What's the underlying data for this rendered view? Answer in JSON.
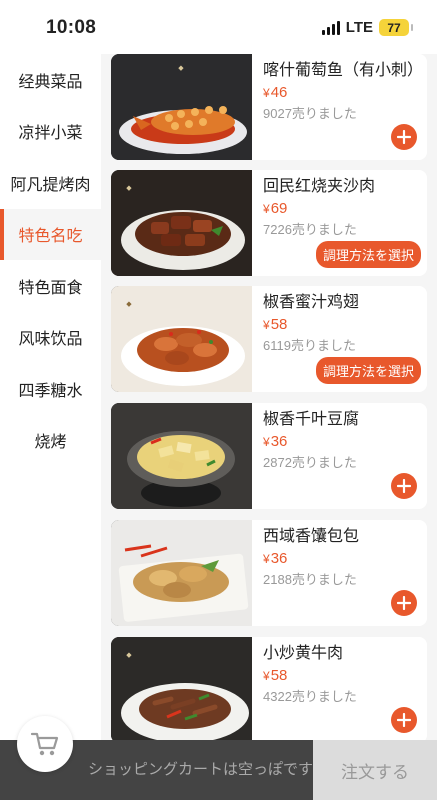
{
  "status": {
    "time": "10:08",
    "network": "LTE",
    "battery": "77"
  },
  "sidebar": {
    "items": [
      {
        "label": "经典菜品",
        "active": false
      },
      {
        "label": "凉拌小菜",
        "active": false
      },
      {
        "label": "阿凡提烤肉",
        "active": false
      },
      {
        "label": "特色名吃",
        "active": true
      },
      {
        "label": "特色面食",
        "active": false
      },
      {
        "label": "风味饮品",
        "active": false
      },
      {
        "label": "四季糖水",
        "active": false
      },
      {
        "label": "烧烤",
        "active": false
      }
    ]
  },
  "menu": {
    "currency": "¥",
    "items": [
      {
        "name": "喀什葡萄鱼（有小刺）",
        "price": "46",
        "sold": "9027売りました",
        "action": "add"
      },
      {
        "name": "回民红烧夹沙肉",
        "price": "69",
        "sold": "7226売りました",
        "action": "option",
        "option_label": "調理方法を選択"
      },
      {
        "name": "椒香蜜汁鸡翅",
        "price": "58",
        "sold": "6119売りました",
        "action": "option",
        "option_label": "調理方法を選択"
      },
      {
        "name": "椒香千叶豆腐",
        "price": "36",
        "sold": "2872売りました",
        "action": "add"
      },
      {
        "name": "西域香馕包包",
        "price": "36",
        "sold": "2188売りました",
        "action": "add"
      },
      {
        "name": "小炒黄牛肉",
        "price": "58",
        "sold": "4322売りました",
        "action": "add"
      }
    ]
  },
  "cart": {
    "empty_text": "ショッピングカートは空っぽです",
    "order_label": "注文する"
  },
  "colors": {
    "accent": "#e8582c",
    "cart_bar": "#444444"
  }
}
